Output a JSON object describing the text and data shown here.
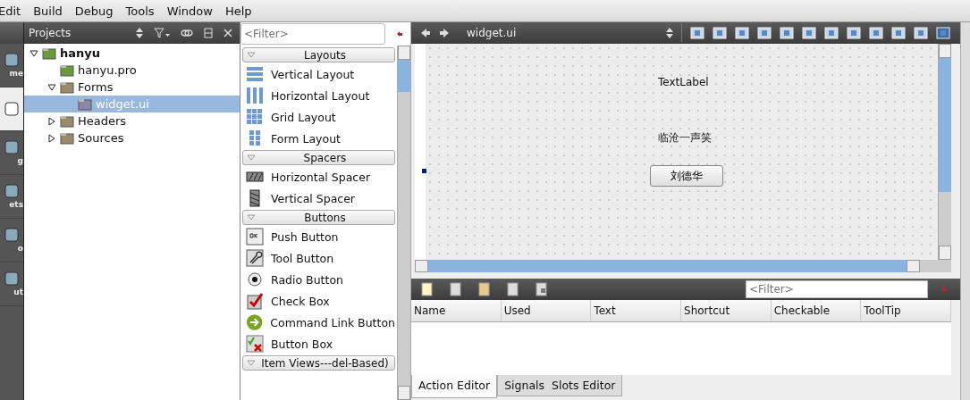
{
  "menu": [
    "Edit",
    "Build",
    "Debug",
    "Tools",
    "Window",
    "Help"
  ],
  "modes": [
    {
      "label": "me",
      "selected": false
    },
    {
      "selected": true
    },
    {
      "label": "g",
      "selected": false
    },
    {
      "label": "ets",
      "selected": false
    },
    {
      "label": "o",
      "selected": false
    },
    {
      "label": "ut",
      "selected": false
    }
  ],
  "projects": {
    "title": "Projects",
    "tree": [
      {
        "label": "hanyu",
        "kind": "project",
        "expanded": true,
        "children": [
          {
            "label": "hanyu.pro",
            "kind": "pro",
            "selected": false
          },
          {
            "label": "Forms",
            "kind": "folder",
            "expanded": true,
            "children": [
              {
                "label": "widget.ui",
                "kind": "ui",
                "selected": true
              }
            ]
          },
          {
            "label": "Headers",
            "kind": "folder",
            "expanded": false
          },
          {
            "label": "Sources",
            "kind": "folder",
            "expanded": false
          }
        ]
      }
    ]
  },
  "widget_box": {
    "filter": {
      "placeholder": "<Filter>"
    },
    "groups": [
      {
        "title": "Layouts",
        "items": [
          {
            "label": "Vertical Layout",
            "kind": "vlayout"
          },
          {
            "label": "Horizontal Layout",
            "kind": "hlayout"
          },
          {
            "label": "Grid Layout",
            "kind": "grid"
          },
          {
            "label": "Form Layout",
            "kind": "form"
          }
        ]
      },
      {
        "title": "Spacers",
        "items": [
          {
            "label": "Horizontal Spacer",
            "kind": "hspacer"
          },
          {
            "label": "Vertical Spacer",
            "kind": "vspacer"
          }
        ]
      },
      {
        "title": "Buttons",
        "items": [
          {
            "label": "Push Button",
            "kind": "push"
          },
          {
            "label": "Tool Button",
            "kind": "tool"
          },
          {
            "label": "Radio Button",
            "kind": "radio"
          },
          {
            "label": "Check Box",
            "kind": "check"
          },
          {
            "label": "Command Link Button",
            "kind": "command"
          },
          {
            "label": "Button Box",
            "kind": "buttonbox"
          }
        ]
      },
      {
        "title": "Item Views---del-Based)"
      }
    ]
  },
  "editor": {
    "file": "widget.ui",
    "form": {
      "label_1": "TextLabel",
      "label_2": "临沧一声笑",
      "button": "刘德华"
    }
  },
  "action_editor": {
    "filter": {
      "placeholder": "<Filter>"
    },
    "columns": [
      "Name",
      "Used",
      "Text",
      "Shortcut",
      "Checkable",
      "ToolTip"
    ],
    "tabs": [
      {
        "label": "Action Editor",
        "selected": true
      },
      {
        "label": "Signals  Slots Editor",
        "selected": false
      }
    ]
  }
}
